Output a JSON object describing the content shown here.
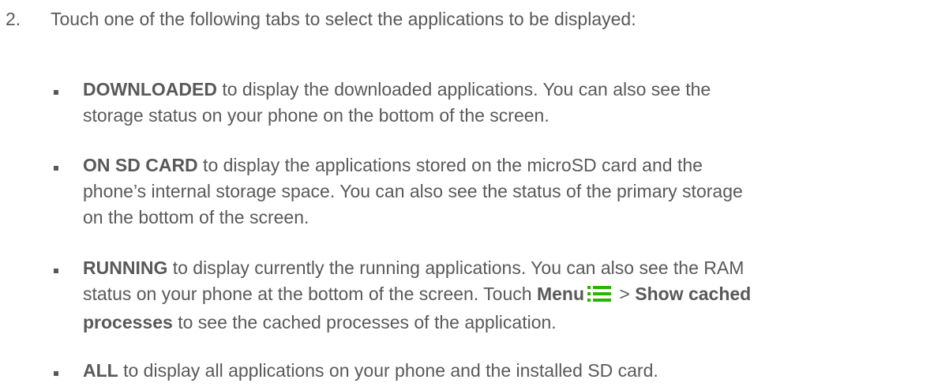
{
  "step": {
    "number": "2.",
    "text": "Touch one of the following tabs to select the applications to be displayed:"
  },
  "bullets": [
    {
      "term": "DOWNLOADED",
      "line1": " to display the downloaded applications. You can also see the",
      "line2": "storage status on your phone on the bottom of the screen."
    },
    {
      "term": "ON SD CARD",
      "line1": " to display the applications stored on the microSD card and the",
      "line2": "phone’s internal storage space. You can also see the status of the primary storage",
      "line3": "on the bottom of the screen."
    },
    {
      "term": "RUNNING",
      "line1": " to display currently the running applications. You can also see the RAM",
      "line2_pre": "status on your phone at the bottom of the screen. Touch ",
      "menu_label": "Menu",
      "menu_icon": "menu-icon",
      "separator": " > ",
      "show_cached": "Show cached",
      "processes": "processes",
      "line3_post": " to see the cached processes of the application."
    },
    {
      "term": "ALL",
      "line1": " to display all applications on your phone and the installed SD card."
    }
  ],
  "colors": {
    "text": "#595959",
    "menu_icon": "#2db200"
  }
}
